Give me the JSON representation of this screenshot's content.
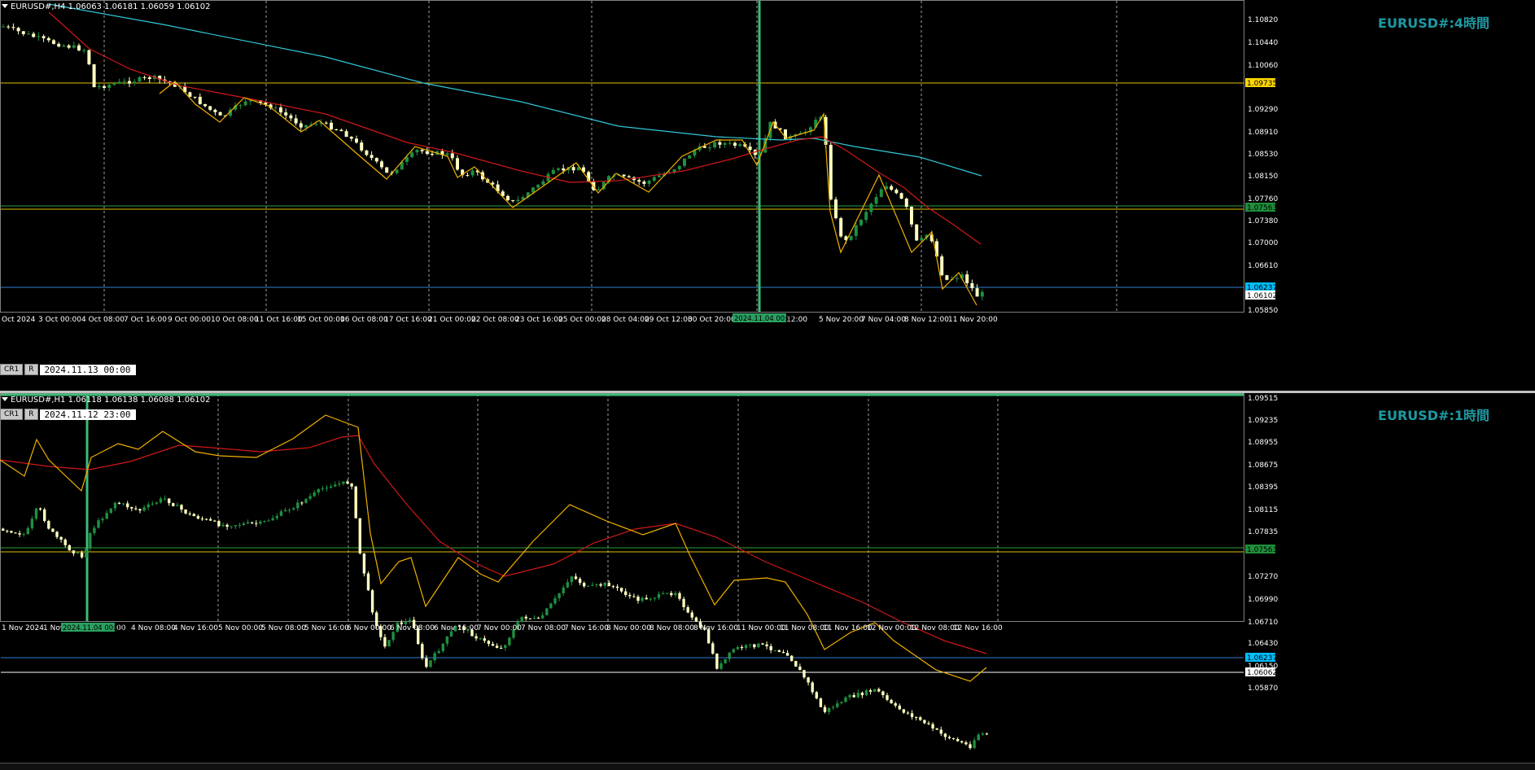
{
  "h4": {
    "header": "EURUSD#,H4  1.06063 1.06181 1.06059 1.06102",
    "title": "EURUSD#:4時間",
    "cursor_btn1": "CR1",
    "cursor_btn2": "R",
    "cursor_time": "2024.11.13 00:00",
    "price_labels": [
      "1.10820",
      "1.10440",
      "1.10060",
      "1.09290",
      "1.08910",
      "1.08530",
      "1.08150",
      "1.07760",
      "1.07380",
      "1.07000",
      "1.06610",
      "1.05850"
    ],
    "tags": [
      {
        "text": "1.09735",
        "bg": "#ffd700",
        "fg": "#000"
      },
      {
        "text": "1.07563",
        "bg": "#1f8f3a",
        "fg": "#000"
      },
      {
        "text": "1.06237",
        "bg": "#00bfff",
        "fg": "#000"
      },
      {
        "text": "1.06102",
        "bg": "#ffffff",
        "fg": "#000"
      }
    ],
    "time_labels": [
      "Oct 2024",
      "3 Oct 00:00",
      "4 Oct 08:00",
      "7 Oct 16:00",
      "9 Oct 00:00",
      "10 Oct 08:00",
      "11 Oct 16:00",
      "15 Oct 00:00",
      "16 Oct 08:00",
      "17 Oct 16:00",
      "21 Oct 00:00",
      "22 Oct 08:00",
      "23 Oct 16:00",
      "25 Oct 00:00",
      "28 Oct 04:00",
      "29 Oct 12:00",
      "30 Oct 20:00",
      "v 12:00",
      "5 Nov 20:00",
      "7 Nov 04:00",
      "8 Nov 12:00",
      "11 Nov 20:00"
    ],
    "highlight_time": "2024.11.04 00:00"
  },
  "h1": {
    "header": "EURUSD#,H1  1.06118 1.06138 1.06088 1.06102",
    "title": "EURUSD#:1時間",
    "cursor_btn1": "CR1",
    "cursor_btn2": "R",
    "cursor_time": "2024.11.12 23:00",
    "price_labels": [
      "1.09515",
      "1.09235",
      "1.08955",
      "1.08675",
      "1.08395",
      "1.08115",
      "1.07835",
      "1.07270",
      "1.06990",
      "1.06710",
      "1.06430",
      "1.06150",
      "1.05870"
    ],
    "tags": [
      {
        "text": "1.07563",
        "bg": "#1f8f3a",
        "fg": "#000"
      },
      {
        "text": "1.06237",
        "bg": "#00bfff",
        "fg": "#000"
      },
      {
        "text": "1.06062",
        "bg": "#ffffff",
        "fg": "#000"
      }
    ],
    "time_labels": [
      "1 Nov 2024",
      "1 Nov",
      "00",
      "4 Nov 08:00",
      "4 Nov 16:00",
      "5 Nov 00:00",
      "5 Nov 08:00",
      "5 Nov 16:00",
      "6 Nov 00:00",
      "6 Nov 08:00",
      "6 Nov 16:00",
      "7 Nov 00:00",
      "7 Nov 08:00",
      "7 Nov 16:00",
      "8 Nov 00:00",
      "8 Nov 08:00",
      "8 Nov 16:00",
      "11 Nov 00:00",
      "11 Nov 08:00",
      "11 Nov 16:00",
      "12 Nov 00:00",
      "12 Nov 08:00",
      "12 Nov 16:00"
    ],
    "highlight_time": "2024.11.04 00:00"
  },
  "colors": {
    "ma_red": "#d01818",
    "ma_cyan": "#30c8d8",
    "zigzag": "#f0b000",
    "bull": "#1e9040",
    "bear": "#ffffc0",
    "line_yellow": "#e0c000",
    "line_green": "#28a040",
    "line_blue": "#2f7fd0",
    "line_white": "#ffffff",
    "vline": "#3cbc78"
  }
}
